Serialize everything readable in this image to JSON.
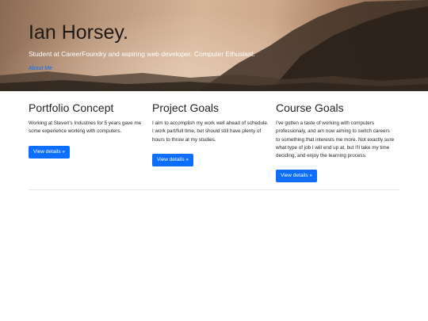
{
  "hero": {
    "title": "Ian Horsey.",
    "lead": "Student at CareerFoundry and aspiring web developer. Computer Ethusiast.",
    "link_label": "About Me"
  },
  "columns": [
    {
      "heading": "Portfolio Concept",
      "body": "Working at Steven's Industries for 5 years gave me some experience working with computers.",
      "button_label": "View details »"
    },
    {
      "heading": "Project Goals",
      "body": "I aim to accomplish my work well ahead of schedule. I work part/full time, but should still have plenty of hours to throw at my studies.",
      "button_label": "View details »"
    },
    {
      "heading": "Course Goals",
      "body": "I've gotten a taste of working with computers professionaly, and am now aiming to switch careers to something that interests me more. Not exactly sure what type of job I will end up at, but I'll take my time deciding, and enjoy the learning process.",
      "button_label": "View details »"
    }
  ],
  "colors": {
    "primary": "#0d6efd",
    "text": "#212529",
    "hero_lead": "#ffffff"
  }
}
